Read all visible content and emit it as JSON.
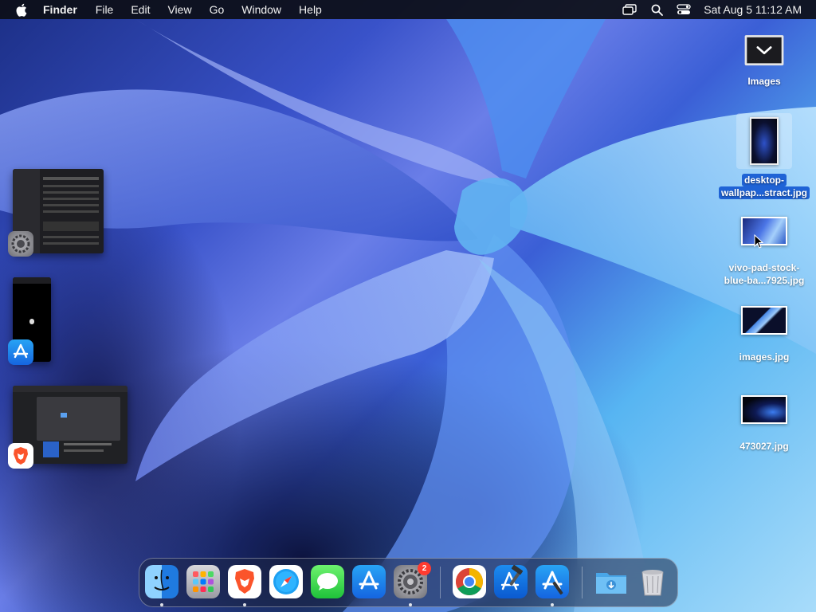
{
  "menubar": {
    "app_name": "Finder",
    "menus": [
      "File",
      "Edit",
      "View",
      "Go",
      "Window",
      "Help"
    ],
    "status_icons": [
      "screen-mirroring-icon",
      "search-icon",
      "control-center-icon"
    ],
    "clock": "Sat Aug 5  11:12 AM"
  },
  "desktop": {
    "icons": [
      {
        "label": "Images",
        "kind": "folder",
        "selected": false
      },
      {
        "label": "desktop-wallpap...stract.jpg",
        "label_line1": "desktop-",
        "label_line2": "wallpap...stract.jpg",
        "selected": true
      },
      {
        "label": "vivo-pad-stock-blue-ba...7925.jpg",
        "label_line1": "vivo-pad-stock-",
        "label_line2": "blue-ba...7925.jpg",
        "selected": false
      },
      {
        "label": "images.jpg",
        "selected": false
      },
      {
        "label": "473027.jpg",
        "selected": false
      }
    ]
  },
  "stage_manager": {
    "groups": [
      {
        "app": "System Settings",
        "icon": "system-settings-icon"
      },
      {
        "app": "App Store",
        "icon": "app-store-icon"
      },
      {
        "app": "Brave Browser",
        "icon": "brave-icon"
      }
    ]
  },
  "dock": {
    "items": [
      {
        "name": "Finder",
        "icon": "finder-icon",
        "running": true
      },
      {
        "name": "Launchpad",
        "icon": "launchpad-icon",
        "running": false
      },
      {
        "name": "Brave Browser",
        "icon": "brave-icon",
        "running": true
      },
      {
        "name": "Safari",
        "icon": "safari-icon",
        "running": false
      },
      {
        "name": "Messages",
        "icon": "messages-icon",
        "running": false
      },
      {
        "name": "App Store",
        "icon": "app-store-icon",
        "running": false
      },
      {
        "name": "System Settings",
        "icon": "system-settings-icon",
        "running": true,
        "badge": "2"
      },
      {
        "name": "Google Chrome",
        "icon": "chrome-icon",
        "running": false
      },
      {
        "name": "Xcode",
        "icon": "xcode-icon",
        "running": false
      },
      {
        "name": "App Store",
        "icon": "app-store-icon",
        "running": true
      },
      {
        "name": "Downloads",
        "icon": "downloads-folder-icon",
        "running": false
      },
      {
        "name": "Trash",
        "icon": "trash-icon",
        "running": false
      }
    ]
  },
  "colors": {
    "selection": "#1f63d6",
    "badge": "#ff3b30"
  }
}
